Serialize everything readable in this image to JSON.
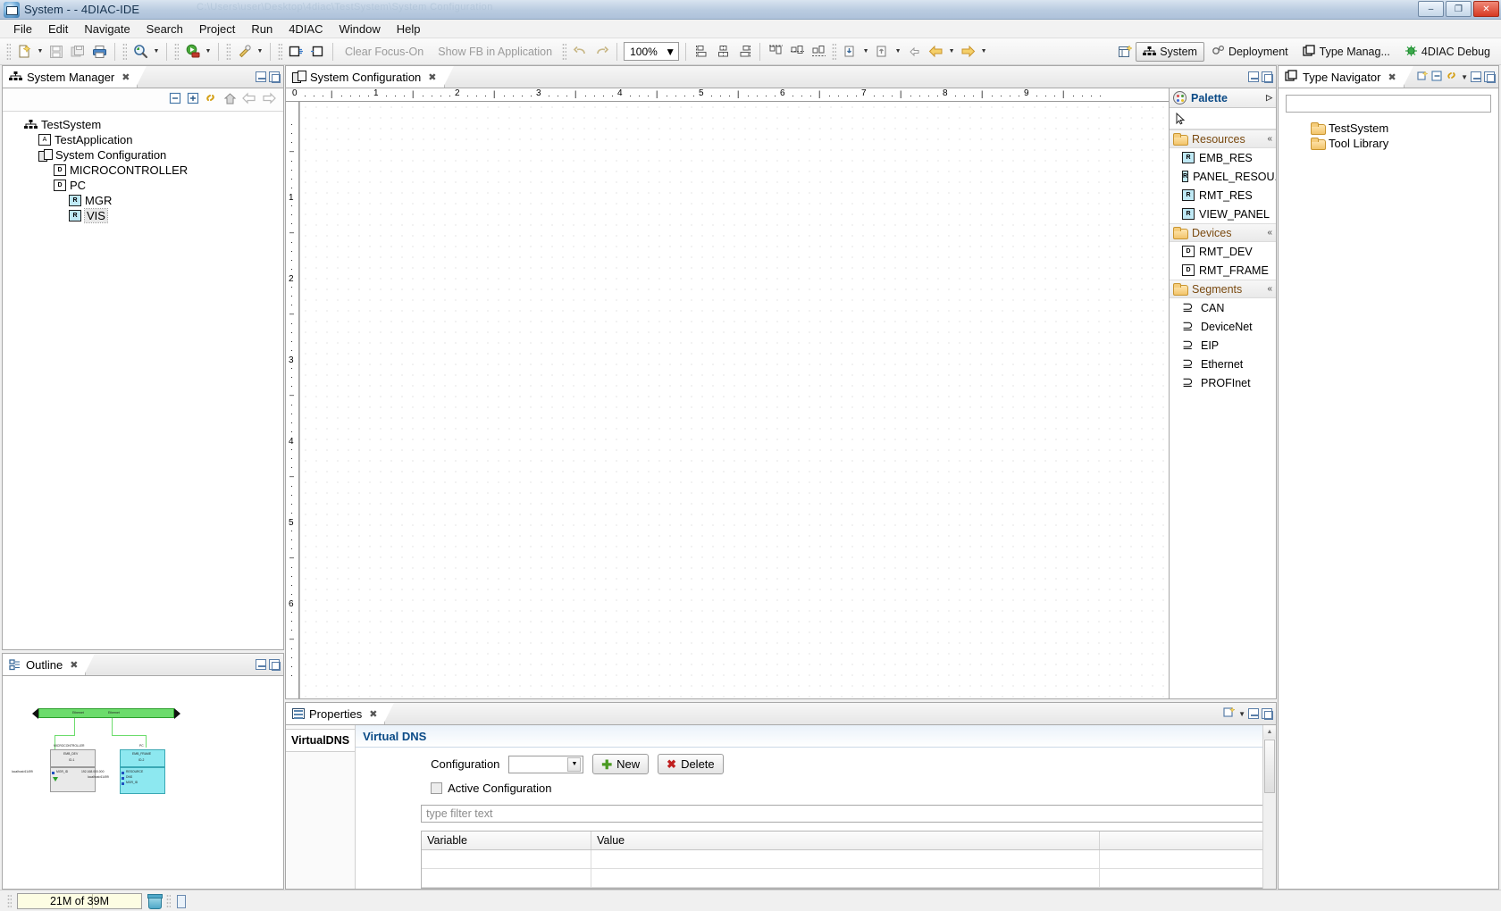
{
  "window": {
    "title": "System -  - 4DIAC-IDE",
    "ghost_text": "C:\\Users\\user\\Desktop\\4diac\\TestSystem\\System Configuration",
    "minimize": "–",
    "maximize": "❐",
    "close": "✕"
  },
  "menu": {
    "items": [
      {
        "label": "File"
      },
      {
        "label": "Edit"
      },
      {
        "label": "Navigate"
      },
      {
        "label": "Search"
      },
      {
        "label": "Project"
      },
      {
        "label": "Run"
      },
      {
        "label": "4DIAC"
      },
      {
        "label": "Window"
      },
      {
        "label": "Help"
      }
    ]
  },
  "toolbar": {
    "clear_focus_on": "Clear Focus-On",
    "show_fb_in_application": "Show FB in Application",
    "zoom_value": "100%",
    "icons": [
      "new-icon",
      "save-icon",
      "save-all-icon",
      "print-icon",
      "search-icon",
      "run-icon",
      "debug-icon",
      "open-type-icon",
      "open-system-icon"
    ],
    "nav_back": "⇦",
    "nav_forward": "⇨"
  },
  "perspectives": {
    "items": [
      {
        "label": "System",
        "icon": "system-icon",
        "active": true
      },
      {
        "label": "Deployment",
        "icon": "deployment-icon",
        "active": false
      },
      {
        "label": "Type Manag...",
        "icon": "type-management-icon",
        "active": false
      },
      {
        "label": "4DIAC Debug",
        "icon": "debug-perspective-icon",
        "active": false
      }
    ]
  },
  "system_manager": {
    "title": "System Manager",
    "close_glyph": "✖",
    "toolbar_icons": [
      "collapse-all-icon",
      "expand-all-icon",
      "link-with-editor-icon",
      "home-icon",
      "back-icon",
      "forward-icon"
    ],
    "tree": [
      {
        "label": "TestSystem",
        "icon": "system-icon",
        "depth": 0,
        "selected": false
      },
      {
        "label": "TestApplication",
        "icon": "application-icon",
        "depth": 1,
        "selected": false
      },
      {
        "label": "System Configuration",
        "icon": "system-configuration-icon",
        "depth": 1,
        "selected": false
      },
      {
        "label": "MICROCONTROLLER",
        "icon": "device-icon",
        "depth": 2,
        "selected": false
      },
      {
        "label": "PC",
        "icon": "device-icon",
        "depth": 2,
        "selected": false
      },
      {
        "label": "MGR",
        "icon": "resource-icon",
        "depth": 3,
        "selected": false
      },
      {
        "label": "VIS",
        "icon": "resource-icon",
        "depth": 3,
        "selected": true
      }
    ]
  },
  "outline": {
    "title": "Outline",
    "close_glyph": "✖",
    "thumbnail": {
      "bus_label_left": "Ethernet",
      "bus_label_right": "Ethernet",
      "left_block": {
        "title": "MICROCONTROLLER",
        "type": "EMB_DEV",
        "id": "ID-1",
        "ports": [
          "MGR_ID"
        ],
        "input_label": "localhost:61499"
      },
      "right_block": {
        "title": "PC",
        "type": "EMB_FRAME",
        "id": "ID-2",
        "ports": [
          "RESOURCE",
          "DNS",
          "MGR_ID"
        ],
        "input_label": "localhost:61499",
        "extra_label": "192.168.000.000"
      }
    }
  },
  "editor": {
    "tab_title": "System Configuration",
    "close_glyph": "✖",
    "ruler_h_labels": [
      "0",
      "1",
      "2",
      "3",
      "4",
      "5",
      "6",
      "7",
      "8",
      "9"
    ],
    "ruler_v_labels": [
      "1",
      "2",
      "3",
      "4",
      "5",
      "6"
    ]
  },
  "palette": {
    "title": "Palette",
    "pin_glyph": "▷",
    "select_tool": "selection-tool",
    "groups": [
      {
        "label": "Resources",
        "icon": "folder-icon",
        "collapse_glyph": "«",
        "items": [
          {
            "label": "EMB_RES",
            "icon": "resource-icon"
          },
          {
            "label": "PANEL_RESOU...",
            "icon": "resource-icon"
          },
          {
            "label": "RMT_RES",
            "icon": "resource-icon"
          },
          {
            "label": "VIEW_PANEL",
            "icon": "resource-icon"
          }
        ]
      },
      {
        "label": "Devices",
        "icon": "folder-icon",
        "collapse_glyph": "«",
        "items": [
          {
            "label": "RMT_DEV",
            "icon": "device-icon"
          },
          {
            "label": "RMT_FRAME",
            "icon": "device-icon"
          }
        ]
      },
      {
        "label": "Segments",
        "icon": "folder-icon",
        "collapse_glyph": "«",
        "items": [
          {
            "label": "CAN",
            "icon": "segment-icon"
          },
          {
            "label": "DeviceNet",
            "icon": "segment-icon"
          },
          {
            "label": "EIP",
            "icon": "segment-icon"
          },
          {
            "label": "Ethernet",
            "icon": "segment-icon"
          },
          {
            "label": "PROFInet",
            "icon": "segment-icon"
          }
        ]
      }
    ]
  },
  "type_navigator": {
    "title": "Type Navigator",
    "close_glyph": "✖",
    "filter_value": "",
    "toolbar_icons": [
      "link-with-editor-icon",
      "collapse-all-icon",
      "refresh-icon",
      "menu-icon",
      "minimize-icon",
      "maximize-icon"
    ],
    "tree": [
      {
        "label": "TestSystem",
        "icon": "folder-icon"
      },
      {
        "label": "Tool Library",
        "icon": "folder-library-icon"
      }
    ]
  },
  "properties": {
    "title": "Properties",
    "close_glyph": "✖",
    "tabs": [
      {
        "label": "VirtualDNS",
        "active": true
      }
    ],
    "section_title": "Virtual DNS",
    "configuration_label": "Configuration",
    "configuration_value": "",
    "new_button": "New",
    "delete_button": "Delete",
    "active_configuration_label": "Active Configuration",
    "active_configuration_checked": false,
    "filter_placeholder": "type filter text",
    "table": {
      "columns": [
        "Variable",
        "Value",
        ""
      ],
      "rows": [
        [
          "",
          "",
          ""
        ],
        [
          "",
          "",
          ""
        ]
      ]
    }
  },
  "statusbar": {
    "heap": "21M of 39M",
    "trash_icon": "trash-icon",
    "extra_icon": "new-wizard-icon"
  },
  "colors": {
    "accent_blue": "#0a4a86",
    "folder_orange": "#7a4a10",
    "resource_cyan": "#bfe9f5",
    "bus_green": "#6cdc6c",
    "block_cyan": "#8de8f0",
    "title_gradient_top": "#d9e4f0",
    "close_red": "#d73a23"
  }
}
